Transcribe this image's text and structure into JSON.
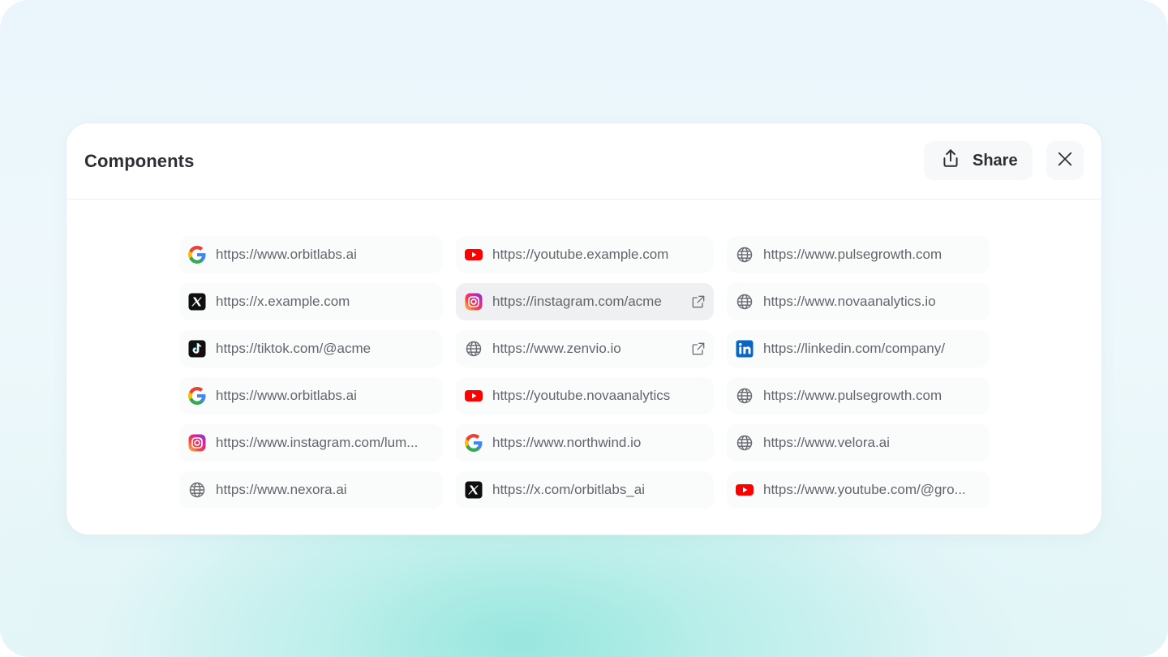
{
  "panel": {
    "title": "Components",
    "share_label": "Share",
    "share_icon": "share-upload-icon",
    "close_icon": "close-icon"
  },
  "links": [
    {
      "icon": "google",
      "url": "https://www.orbitlabs.ai",
      "external": false,
      "active": false
    },
    {
      "icon": "youtube",
      "url": "https://youtube.example.com",
      "external": false,
      "active": false
    },
    {
      "icon": "globe",
      "url": "https://www.pulsegrowth.com",
      "external": false,
      "active": false
    },
    {
      "icon": "x",
      "url": "https://x.example.com",
      "external": false,
      "active": false
    },
    {
      "icon": "instagram",
      "url": "https://instagram.com/acme",
      "external": true,
      "active": true
    },
    {
      "icon": "globe",
      "url": "https://www.novaanalytics.io",
      "external": false,
      "active": false
    },
    {
      "icon": "tiktok",
      "url": "https://tiktok.com/@acme",
      "external": false,
      "active": false
    },
    {
      "icon": "globe",
      "url": "https://www.zenvio.io",
      "external": true,
      "active": false
    },
    {
      "icon": "linkedin",
      "url": "https://linkedin.com/company/",
      "external": false,
      "active": false
    },
    {
      "icon": "google",
      "url": "https://www.orbitlabs.ai",
      "external": false,
      "active": false
    },
    {
      "icon": "youtube",
      "url": "https://youtube.novaanalytics",
      "external": false,
      "active": false
    },
    {
      "icon": "globe",
      "url": "https://www.pulsegrowth.com",
      "external": false,
      "active": false
    },
    {
      "icon": "instagram",
      "url": "https://www.instagram.com/lum...",
      "external": false,
      "active": false
    },
    {
      "icon": "google",
      "url": "https://www.northwind.io",
      "external": false,
      "active": false
    },
    {
      "icon": "globe",
      "url": "https://www.velora.ai",
      "external": false,
      "active": false
    },
    {
      "icon": "globe",
      "url": "https://www.nexora.ai",
      "external": false,
      "active": false
    },
    {
      "icon": "x",
      "url": "https://x.com/orbitlabs_ai",
      "external": false,
      "active": false
    },
    {
      "icon": "youtube",
      "url": "https://www.youtube.com/@gro...",
      "external": false,
      "active": false
    }
  ],
  "colors": {
    "youtube": "#ff0000",
    "linkedin": "#0a66c2",
    "text_muted": "#62666b",
    "title": "#2c2f33"
  }
}
